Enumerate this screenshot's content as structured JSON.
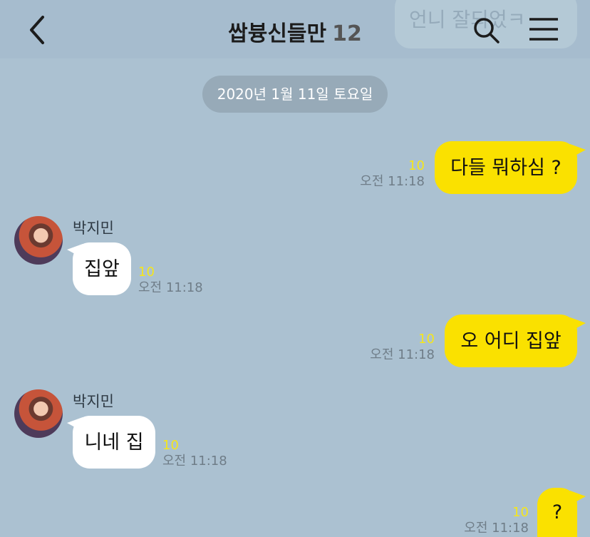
{
  "header": {
    "title": "쌉븅신들만",
    "member_count": "12",
    "overlay_text": "언니 잘되었ㅋ"
  },
  "date_divider": "2020년 1월 11일 토요일",
  "messages": [
    {
      "text": "다들 뭐하심 ?",
      "unread": "10",
      "time": "오전 11:18"
    },
    {
      "sender": "박지민",
      "text": "집앞",
      "unread": "10",
      "time": "오전 11:18"
    },
    {
      "text": "오 어디 집앞",
      "unread": "10",
      "time": "오전 11:18"
    },
    {
      "sender": "박지민",
      "text": "니네 집",
      "unread": "10",
      "time": "오전 11:18"
    },
    {
      "text": "?",
      "unread": "10",
      "time": "오전 11:18"
    }
  ],
  "colors": {
    "background": "#abc1d1",
    "my_bubble": "#fae100",
    "their_bubble": "#ffffff",
    "unread": "#f5e61c"
  }
}
